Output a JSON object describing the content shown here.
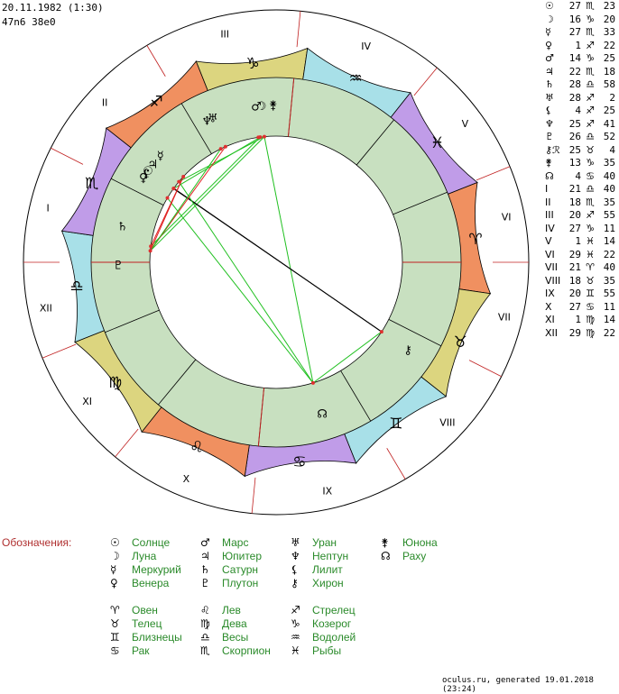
{
  "header": {
    "date": "20.11.1982 (1:30)",
    "coords": "47n6 38e0"
  },
  "house_labels": [
    "I",
    "II",
    "III",
    "IV",
    "V",
    "VI",
    "VII",
    "VIII",
    "IX",
    "X",
    "XI",
    "XII"
  ],
  "planets_table": [
    {
      "glyph": "☉",
      "deg": "27",
      "sign": "♏",
      "min": "23"
    },
    {
      "glyph": "☽",
      "deg": "16",
      "sign": "♑",
      "min": "20"
    },
    {
      "glyph": "☿",
      "deg": "27",
      "sign": "♏",
      "min": "33"
    },
    {
      "glyph": "♀",
      "deg": "1",
      "sign": "♐",
      "min": "22"
    },
    {
      "glyph": "♂",
      "deg": "14",
      "sign": "♑",
      "min": "25"
    },
    {
      "glyph": "♃",
      "deg": "22",
      "sign": "♏",
      "min": "18"
    },
    {
      "glyph": "♄",
      "deg": "28",
      "sign": "♎",
      "min": "58"
    },
    {
      "glyph": "♅",
      "deg": "28",
      "sign": "♐",
      "min": "2"
    },
    {
      "glyph": "⚸",
      "deg": "4",
      "sign": "♐",
      "min": "25"
    },
    {
      "glyph": "♆",
      "deg": "25",
      "sign": "♐",
      "min": "41"
    },
    {
      "glyph": "♇",
      "deg": "26",
      "sign": "♎",
      "min": "52"
    },
    {
      "glyph": "⚷ℛ",
      "deg": "25",
      "sign": "♉",
      "min": "4"
    },
    {
      "glyph": "⚵",
      "deg": "13",
      "sign": "♑",
      "min": "35"
    },
    {
      "glyph": "☊",
      "deg": "4",
      "sign": "♋",
      "min": "40"
    },
    {
      "glyph": "I",
      "deg": "21",
      "sign": "♎",
      "min": "40"
    },
    {
      "glyph": "II",
      "deg": "18",
      "sign": "♏",
      "min": "35"
    },
    {
      "glyph": "III",
      "deg": "20",
      "sign": "♐",
      "min": "55"
    },
    {
      "glyph": "IV",
      "deg": "27",
      "sign": "♑",
      "min": "11"
    },
    {
      "glyph": "V",
      "deg": "1",
      "sign": "♓",
      "min": "14"
    },
    {
      "glyph": "VI",
      "deg": "29",
      "sign": "♓",
      "min": "22"
    },
    {
      "glyph": "VII",
      "deg": "21",
      "sign": "♈",
      "min": "40"
    },
    {
      "glyph": "VIII",
      "deg": "18",
      "sign": "♉",
      "min": "35"
    },
    {
      "glyph": "IX",
      "deg": "20",
      "sign": "♊",
      "min": "55"
    },
    {
      "glyph": "X",
      "deg": "27",
      "sign": "♋",
      "min": "11"
    },
    {
      "glyph": "XI",
      "deg": "1",
      "sign": "♍",
      "min": "14"
    },
    {
      "glyph": "XII",
      "deg": "29",
      "sign": "♍",
      "min": "22"
    }
  ],
  "legend": {
    "title": "Обозначения:",
    "planets": [
      {
        "glyph": "☉",
        "name": "Солнце"
      },
      {
        "glyph": "☽",
        "name": "Луна"
      },
      {
        "glyph": "☿",
        "name": "Меркурий"
      },
      {
        "glyph": "♀",
        "name": "Венера"
      },
      {
        "glyph": "♂",
        "name": "Марс"
      },
      {
        "glyph": "♃",
        "name": "Юпитер"
      },
      {
        "glyph": "♄",
        "name": "Сатурн"
      },
      {
        "glyph": "♇",
        "name": "Плутон"
      },
      {
        "glyph": "♅",
        "name": "Уран"
      },
      {
        "glyph": "♆",
        "name": "Нептун"
      },
      {
        "glyph": "⚸",
        "name": "Лилит"
      },
      {
        "glyph": "⚷",
        "name": "Хирон"
      },
      {
        "glyph": "⚵",
        "name": "Юнона"
      },
      {
        "glyph": "☊",
        "name": "Раху"
      }
    ],
    "signs": [
      {
        "glyph": "♈",
        "name": "Овен"
      },
      {
        "glyph": "♉",
        "name": "Телец"
      },
      {
        "glyph": "♊",
        "name": "Близнецы"
      },
      {
        "glyph": "♋",
        "name": "Рак"
      },
      {
        "glyph": "♌",
        "name": "Лев"
      },
      {
        "glyph": "♍",
        "name": "Дева"
      },
      {
        "glyph": "♎",
        "name": "Весы"
      },
      {
        "glyph": "♏",
        "name": "Скорпион"
      },
      {
        "glyph": "♐",
        "name": "Стрелец"
      },
      {
        "glyph": "♑",
        "name": "Козерог"
      },
      {
        "glyph": "♒",
        "name": "Водолей"
      },
      {
        "glyph": "♓",
        "name": "Рыбы"
      }
    ]
  },
  "footer": "oculus.ru, generated 19.01.2018 (23:24)",
  "chart_data": {
    "type": "natal-wheel",
    "ascendant": {
      "sign": "Libra",
      "deg": 21.67
    },
    "signs": [
      {
        "name": "Aries",
        "glyph": "♈",
        "color": "#f09060"
      },
      {
        "name": "Taurus",
        "glyph": "♉",
        "color": "#dcd57f"
      },
      {
        "name": "Gemini",
        "glyph": "♊",
        "color": "#a8e0e8"
      },
      {
        "name": "Cancer",
        "glyph": "♋",
        "color": "#c09ce8"
      },
      {
        "name": "Leo",
        "glyph": "♌",
        "color": "#f09060"
      },
      {
        "name": "Virgo",
        "glyph": "♍",
        "color": "#dcd57f"
      },
      {
        "name": "Libra",
        "glyph": "♎",
        "color": "#a8e0e8"
      },
      {
        "name": "Scorpio",
        "glyph": "♏",
        "color": "#c09ce8"
      },
      {
        "name": "Sagittarius",
        "glyph": "♐",
        "color": "#f09060"
      },
      {
        "name": "Capricorn",
        "glyph": "♑",
        "color": "#dcd57f"
      },
      {
        "name": "Aquarius",
        "glyph": "♒",
        "color": "#a8e0e8"
      },
      {
        "name": "Pisces",
        "glyph": "♓",
        "color": "#c09ce8"
      }
    ],
    "cusps_deg": [
      201.67,
      228.58,
      260.92,
      297.18,
      331.23,
      359.37,
      21.67,
      48.58,
      80.92,
      117.18,
      151.23,
      179.37
    ],
    "planets": [
      {
        "glyph": "☉",
        "deg": 237.38
      },
      {
        "glyph": "☽",
        "deg": 286.33
      },
      {
        "glyph": "☿",
        "deg": 237.55
      },
      {
        "glyph": "♀",
        "deg": 241.37
      },
      {
        "glyph": "♂",
        "deg": 284.42
      },
      {
        "glyph": "♃",
        "deg": 232.3
      },
      {
        "glyph": "♄",
        "deg": 208.97
      },
      {
        "glyph": "♅",
        "deg": 268.03
      },
      {
        "glyph": "⚸",
        "deg": 244.42
      },
      {
        "glyph": "♆",
        "deg": 265.68
      },
      {
        "glyph": "♇",
        "deg": 206.87
      },
      {
        "glyph": "⚷",
        "deg": 55.07
      },
      {
        "glyph": "⚵",
        "deg": 283.58
      },
      {
        "glyph": "☊",
        "deg": 94.67
      }
    ],
    "aspects": [
      {
        "a": 1,
        "b": 3,
        "color": "#20c020"
      },
      {
        "a": 1,
        "b": 4,
        "color": "#20c020"
      },
      {
        "a": 1,
        "b": 13,
        "color": "#20c020"
      },
      {
        "a": 4,
        "b": 6,
        "color": "#20c020"
      },
      {
        "a": 1,
        "b": 10,
        "color": "#20c020"
      },
      {
        "a": 4,
        "b": 0,
        "color": "#20c020"
      },
      {
        "a": 5,
        "b": 13,
        "color": "#20c020"
      },
      {
        "a": 0,
        "b": 11,
        "color": "#000000"
      },
      {
        "a": 2,
        "b": 11,
        "color": "#000000"
      },
      {
        "a": 11,
        "b": 13,
        "color": "#20c020"
      },
      {
        "a": 3,
        "b": 13,
        "color": "#20c020"
      },
      {
        "a": 8,
        "b": 6,
        "color": "#e02020"
      },
      {
        "a": 7,
        "b": 10,
        "color": "#e02020"
      },
      {
        "a": 9,
        "b": 10,
        "color": "#20c020"
      },
      {
        "a": 8,
        "b": 10,
        "color": "#e02020"
      }
    ]
  }
}
